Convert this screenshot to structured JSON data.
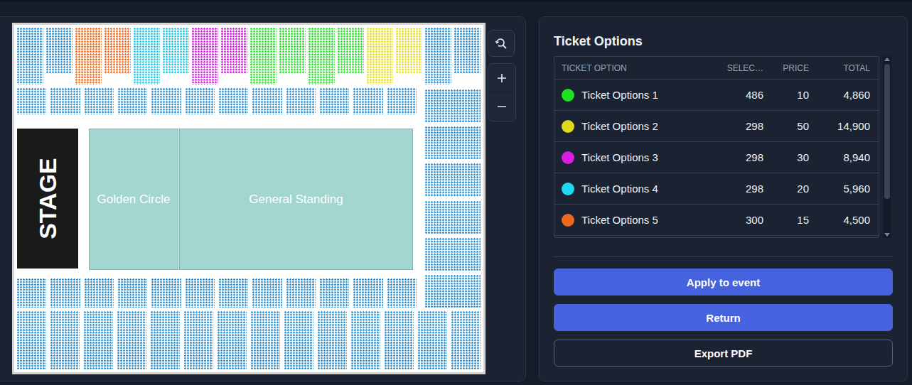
{
  "map": {
    "stage": "STAGE",
    "areas": [
      {
        "label": "Golden Circle"
      },
      {
        "label": "General Standing"
      }
    ],
    "top_sections": [
      {
        "color": "#2d8fd0"
      },
      {
        "color": "#f26b1d"
      },
      {
        "color": "#22c8e6"
      },
      {
        "color": "#d21ee0"
      },
      {
        "color": "#2ee02e"
      },
      {
        "color": "#2ee02e"
      },
      {
        "color": "#e6e01e"
      },
      {
        "color": "#2d8fd0"
      }
    ]
  },
  "panel": {
    "title": "Ticket Options"
  },
  "table": {
    "columns": [
      "TICKET OPTION",
      "SELEC…",
      "PRICE",
      "TOTAL"
    ],
    "rows": [
      {
        "name": "Ticket Options 1",
        "count": "486",
        "price": "10",
        "total": "4,860",
        "color": "#1ee01e"
      },
      {
        "name": "Ticket Options 2",
        "count": "298",
        "price": "50",
        "total": "14,900",
        "color": "#e0d81e"
      },
      {
        "name": "Ticket Options 3",
        "count": "298",
        "price": "30",
        "total": "8,940",
        "color": "#d81ee0"
      },
      {
        "name": "Ticket Options 4",
        "count": "298",
        "price": "20",
        "total": "5,960",
        "color": "#1ed8f0"
      },
      {
        "name": "Ticket Options 5",
        "count": "300",
        "price": "15",
        "total": "4,500",
        "color": "#f0661e"
      }
    ]
  },
  "buttons": [
    {
      "label": "Apply to event",
      "kind": "primary"
    },
    {
      "label": "Return",
      "kind": "primary"
    },
    {
      "label": "Export PDF",
      "kind": "outline"
    }
  ]
}
